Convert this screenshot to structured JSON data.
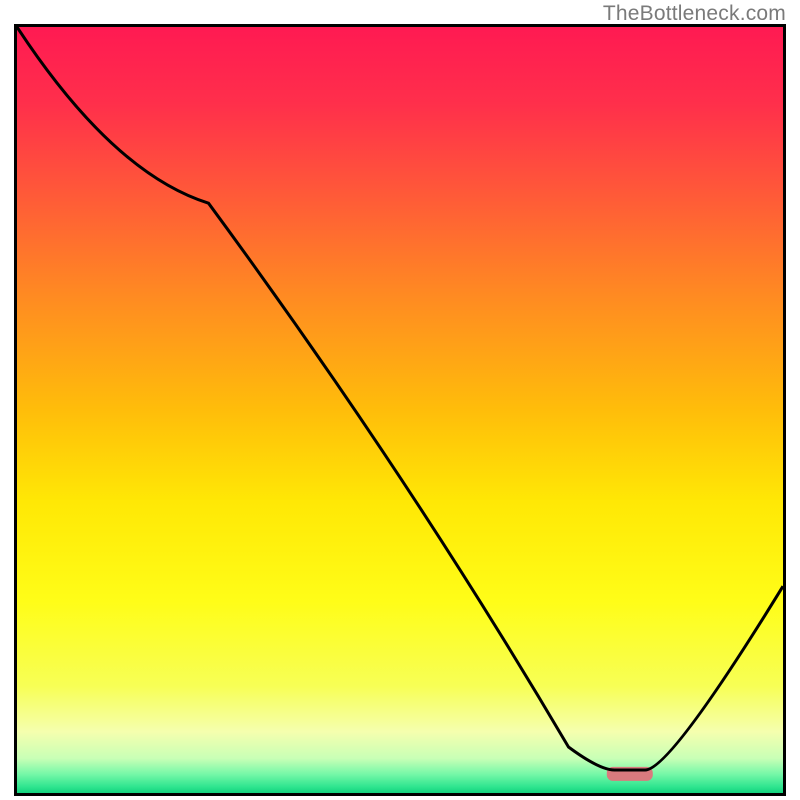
{
  "watermark": "TheBottleneck.com",
  "chart_data": {
    "type": "line",
    "title": "",
    "xlabel": "",
    "ylabel": "",
    "xlim": [
      0,
      100
    ],
    "ylim": [
      0,
      100
    ],
    "grid": false,
    "series": [
      {
        "name": "curve",
        "x": [
          0,
          25,
          72,
          78,
          82,
          100
        ],
        "y": [
          100,
          77,
          6,
          3,
          3,
          27
        ]
      }
    ],
    "marker": {
      "x_start": 77,
      "x_end": 83,
      "y": 2.5,
      "color": "#d97a7e"
    },
    "background_gradient": {
      "stops": [
        {
          "offset": 0.0,
          "color": "#ff1a52"
        },
        {
          "offset": 0.1,
          "color": "#ff2f4b"
        },
        {
          "offset": 0.22,
          "color": "#ff5a38"
        },
        {
          "offset": 0.35,
          "color": "#ff8a22"
        },
        {
          "offset": 0.5,
          "color": "#ffbd0a"
        },
        {
          "offset": 0.62,
          "color": "#ffe805"
        },
        {
          "offset": 0.75,
          "color": "#fffd18"
        },
        {
          "offset": 0.86,
          "color": "#f7ff55"
        },
        {
          "offset": 0.92,
          "color": "#f5ffae"
        },
        {
          "offset": 0.955,
          "color": "#c8ffb6"
        },
        {
          "offset": 0.975,
          "color": "#77f8a8"
        },
        {
          "offset": 0.992,
          "color": "#2fe58f"
        },
        {
          "offset": 1.0,
          "color": "#13d37e"
        }
      ]
    }
  }
}
